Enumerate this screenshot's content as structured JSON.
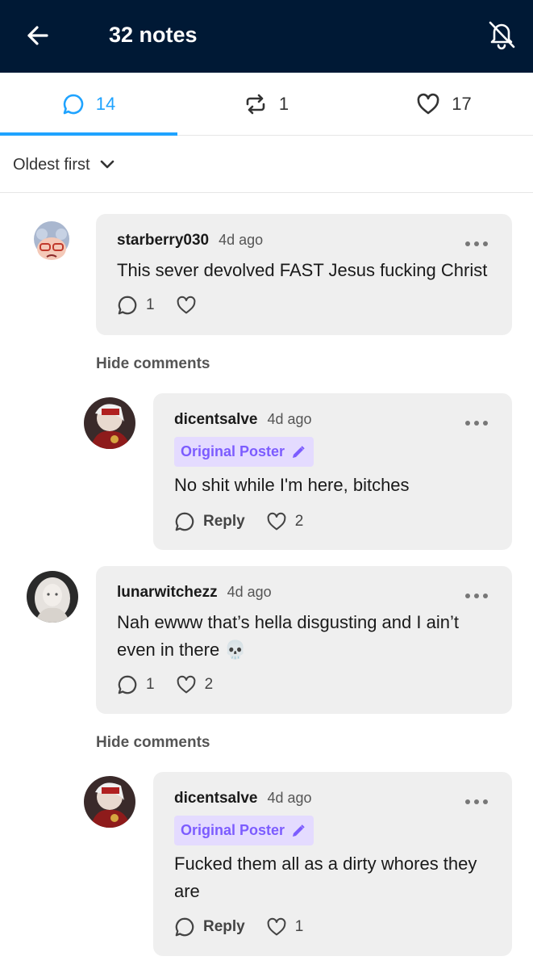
{
  "header": {
    "title": "32 notes"
  },
  "tabs": {
    "comments_count": "14",
    "reblogs_count": "1",
    "likes_count": "17"
  },
  "sort": {
    "label": "Oldest first"
  },
  "comments": [
    {
      "user": "starberry030",
      "time": "4d ago",
      "text": "This sever devolved FAST Jesus fucking Christ",
      "reply_count": "1",
      "toggle_label": "Hide comments",
      "replies": [
        {
          "user": "dicentsalve",
          "time": "4d ago",
          "badge": "Original Poster",
          "text": "No shit while I'm here, bitches",
          "reply_label": "Reply",
          "like_count": "2"
        }
      ]
    },
    {
      "user": "lunarwitchezz",
      "time": "4d ago",
      "text": "Nah ewww that’s hella disgusting and I ain’t even in there 💀",
      "reply_count": "1",
      "like_count": "2",
      "toggle_label": "Hide comments",
      "replies": [
        {
          "user": "dicentsalve",
          "time": "4d ago",
          "badge": "Original Poster",
          "text": "Fucked them all as a dirty whores they are",
          "reply_label": "Reply",
          "like_count": "1"
        }
      ]
    }
  ],
  "colors": {
    "header_bg": "#001935",
    "accent": "#1fa3ff",
    "op_badge_bg": "#e4dbff",
    "op_badge_text": "#7c5cff",
    "bubble_bg": "#efefef"
  }
}
